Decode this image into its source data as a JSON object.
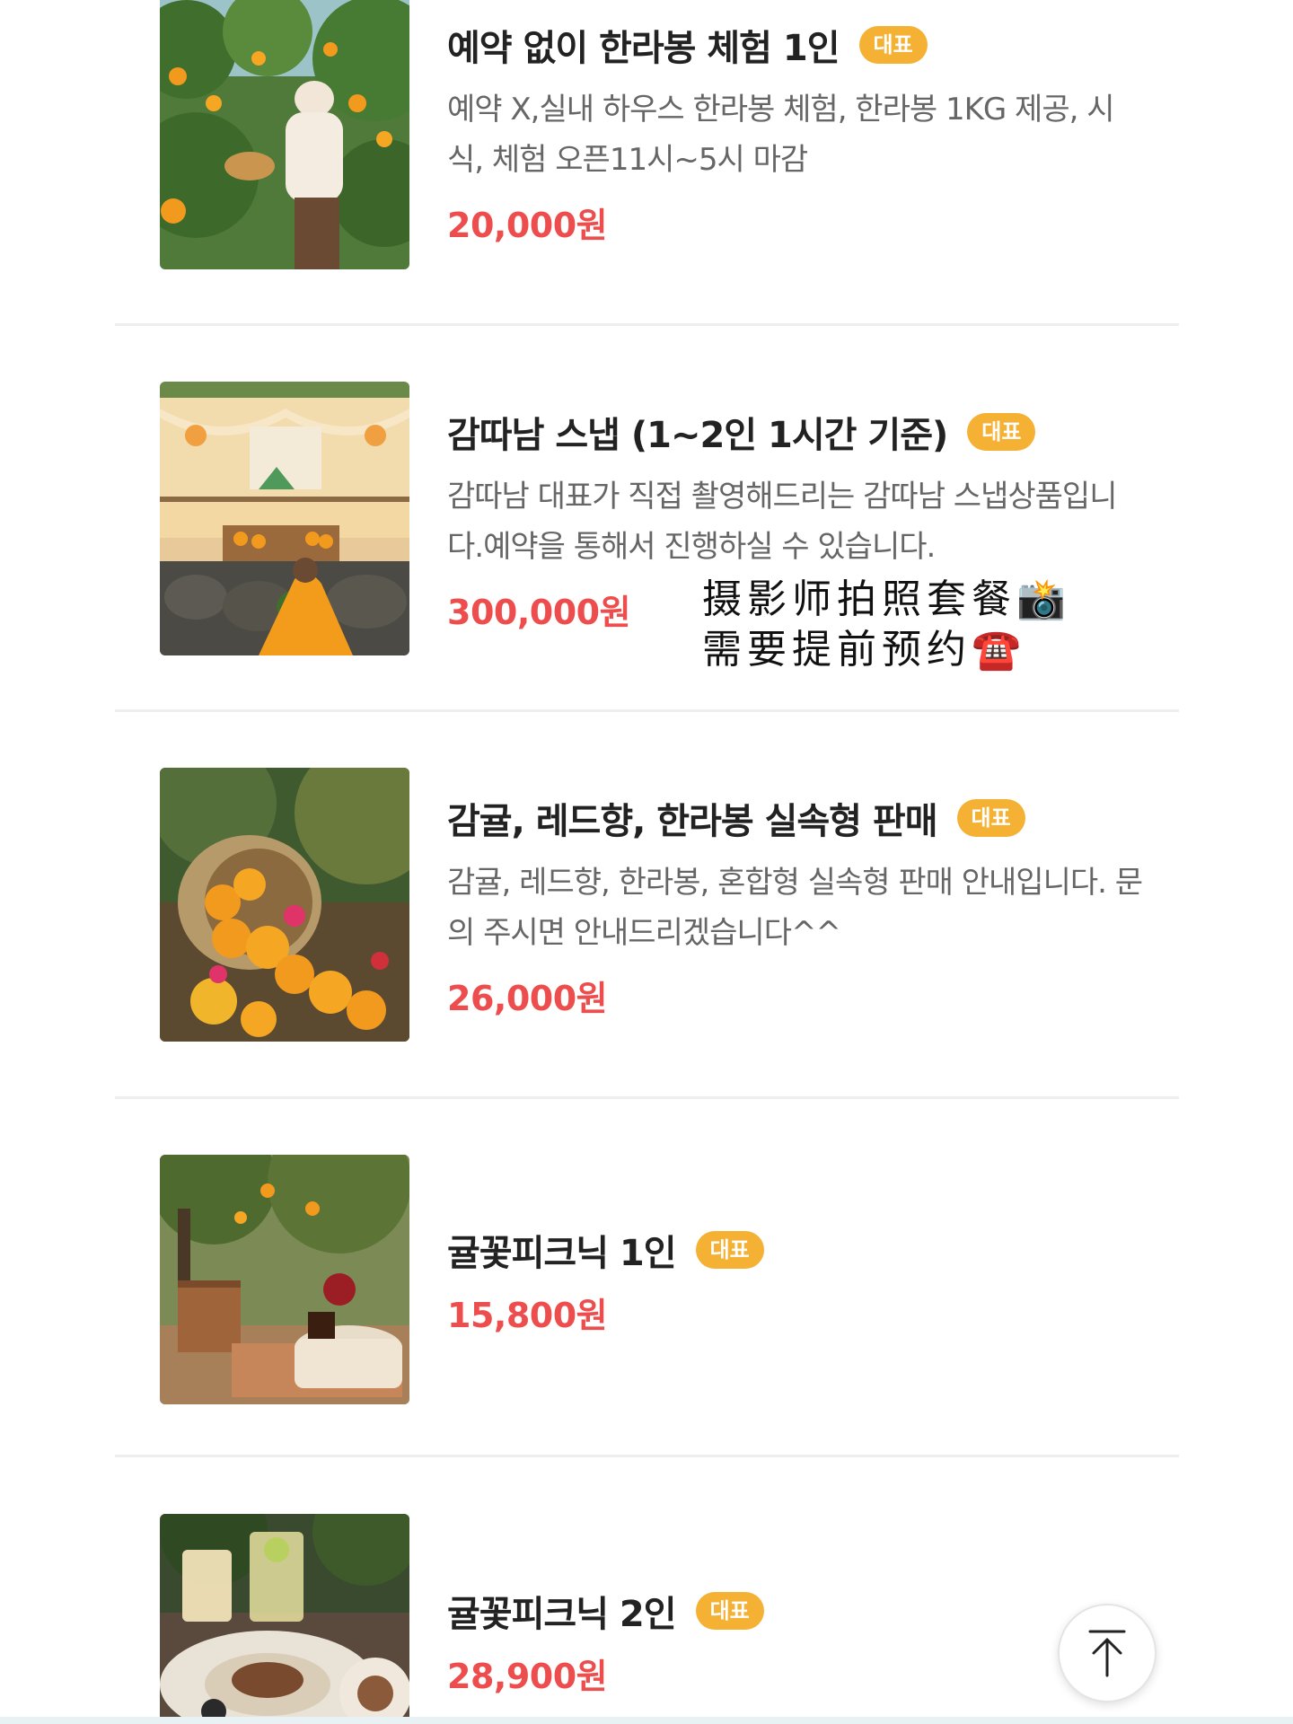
{
  "badge_label": "대표",
  "colors": {
    "price": "#ee4d4d",
    "badge": "#f5b133",
    "title": "#222222",
    "description": "#666666"
  },
  "products": [
    {
      "title": "예약 없이 한라봉 체험 1인",
      "description": "예약 X,실내 하우스 한라봉 체험, 한라봉 1KG 제공, 시식, 체험 오픈11시~5시 마감",
      "price": "20,000원"
    },
    {
      "title": "감따남 스냅 (1~2인 1시간 기준)",
      "description": "감따남 대표가 직접 촬영해드리는 감따남 스냅상품입니다.예약을 통해서 진행하실 수 있습니다.",
      "price": "300,000원"
    },
    {
      "title": "감귤, 레드향, 한라봉 실속형 판매",
      "description": "감귤, 레드향, 한라봉, 혼합형 실속형 판매 안내입니다. 문의 주시면 안내드리겠습니다^^",
      "price": "26,000원"
    },
    {
      "title": "귤꽃피크닉 1인",
      "description": "",
      "price": "15,800원"
    },
    {
      "title": "귤꽃피크닉 2인",
      "description": "",
      "price": "28,900원"
    }
  ],
  "handwritten_note": {
    "line1": "摄影师拍照套餐📸",
    "line2": "需要提前预约☎️"
  },
  "scroll_top_icon": "arrow-up-to-top-icon"
}
